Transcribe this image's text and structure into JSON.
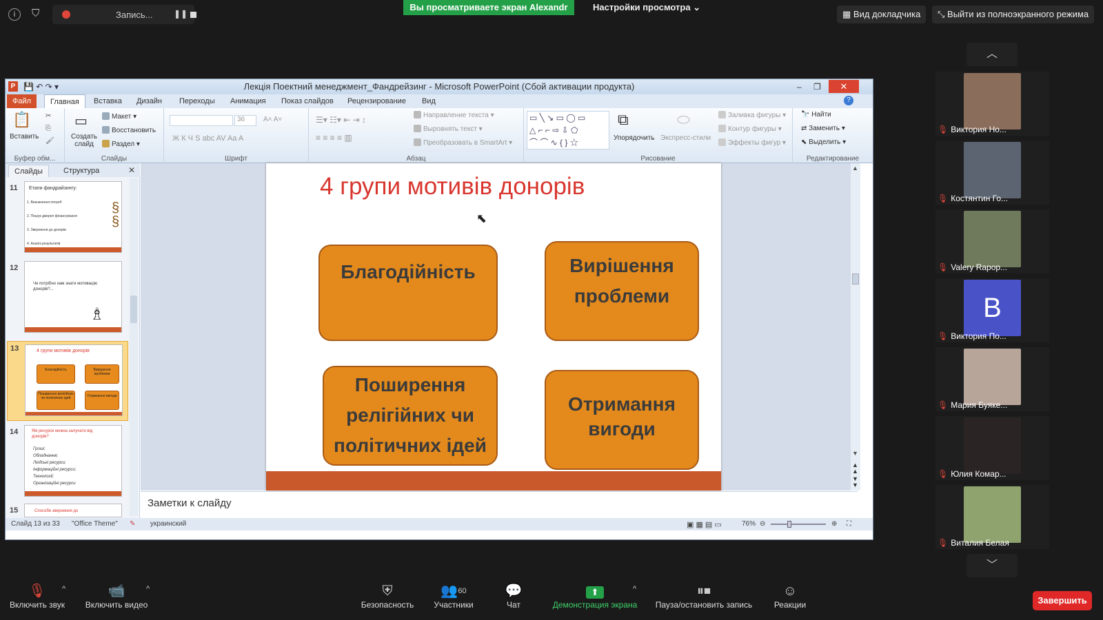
{
  "zoom_top": {
    "recording_label": "Запись...",
    "viewing_banner": "Вы просматриваете экран Alexandr",
    "view_options": "Настройки просмотра",
    "speaker_view": "Вид докладчика",
    "exit_fullscreen": "Выйти из полноэкранного режима"
  },
  "ppt": {
    "window_title": "Лекція Поектний менеджмент_Фандрейзинг  -  Microsoft PowerPoint (Сбой активации продукта)",
    "tabs": [
      "Файл",
      "Главная",
      "Вставка",
      "Дизайн",
      "Переходы",
      "Анимация",
      "Показ слайдов",
      "Рецензирование",
      "Вид"
    ],
    "ribbon": {
      "paste": "Вставить",
      "clipboard_group": "Буфер обм...",
      "new_slide": "Создать слайд",
      "layout": "Макет",
      "reset": "Восстановить",
      "section": "Раздел",
      "slides_group": "Слайды",
      "font_size": "36",
      "font_group": "Шрифт",
      "text_direction": "Направление текста",
      "align_text": "Выровнять текст",
      "convert_smartart": "Преобразовать в SmartArt",
      "paragraph_group": "Абзац",
      "arrange": "Упорядочить",
      "quick_styles": "Экспресс-стили",
      "shape_fill": "Заливка фигуры",
      "shape_outline": "Контур фигуры",
      "shape_effects": "Эффекты фигур",
      "drawing_group": "Рисование",
      "find": "Найти",
      "replace": "Заменить",
      "select": "Выделить",
      "editing_group": "Редактирование"
    },
    "pane_tabs": [
      "Слайды",
      "Структура"
    ],
    "thumbnails": [
      {
        "num": "11",
        "lines": [
          "Етапи фандрайзингу:",
          "1. Визначення потреб",
          "2. Пошук джерел фінансування",
          "3. Звернення до донорів",
          "4. Аналіз результатів"
        ]
      },
      {
        "num": "12",
        "lines": [
          "Чи потрібно нам знати мотивацію донорів?..."
        ]
      },
      {
        "num": "13",
        "lines": [
          "4 групи мотивів донорів"
        ],
        "boxes": [
          "Благодійність",
          "Вирішення проблеми",
          "Поширення релігійних чи політичних ідей",
          "Отримання вигоди"
        ]
      },
      {
        "num": "14",
        "lines": [
          "Які ресурси можна залучати від донорів?",
          "Гроші;",
          "Обладнання;",
          "Людські ресурси;",
          "Інформаційні ресурси;",
          "Технології;",
          "Організаційні ресурси"
        ]
      },
      {
        "num": "15",
        "lines": [
          "Способи звернення до"
        ]
      }
    ],
    "slide": {
      "title": "4 групи мотивів донорів",
      "boxes": [
        "Благодійність",
        "Вирішення проблеми",
        "Поширення релігійних чи політичних ідей",
        "Отримання вигоди"
      ]
    },
    "notes_placeholder": "Заметки к слайду",
    "status": {
      "slide_of": "Слайд 13 из 33",
      "theme": "\"Office Theme\"",
      "language": "украинский",
      "zoom": "76%"
    }
  },
  "participants": [
    {
      "name": "Виктория Но...",
      "color": "#8a6d5a"
    },
    {
      "name": "Костянтин Го...",
      "color": "#5b6470"
    },
    {
      "name": "Valery Rapop...",
      "color": "#6f7a5c"
    },
    {
      "name": "Виктория По...",
      "initial": "B",
      "color": "#4a52c8"
    },
    {
      "name": "Мария Буяке...",
      "color": "#b8a59a"
    },
    {
      "name": "Юлия Комар...",
      "color": "#2b2424"
    },
    {
      "name": "Виталия Белая",
      "color": "#8fa36f"
    }
  ],
  "bottom": {
    "unmute": "Включить звук",
    "start_video": "Включить видео",
    "security": "Безопасность",
    "participants": "Участники",
    "participants_count": "60",
    "chat": "Чат",
    "share_screen": "Демонстрация экрана",
    "pause_record": "Пауза/остановить запись",
    "reactions": "Реакции",
    "end": "Завершить"
  }
}
